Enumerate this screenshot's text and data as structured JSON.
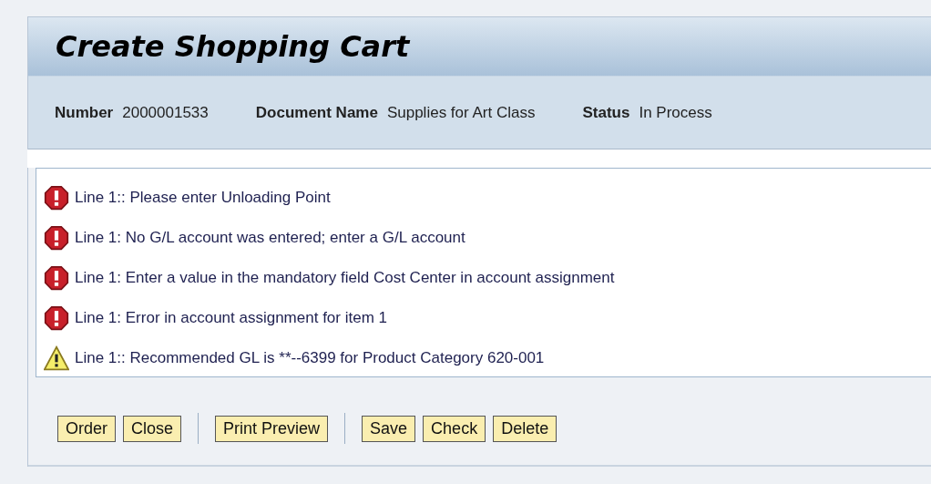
{
  "title": "Create Shopping Cart",
  "header_fields": [
    {
      "label": "Number",
      "value": "2000001533"
    },
    {
      "label": "Document Name",
      "value": "Supplies for Art Class"
    },
    {
      "label": "Status",
      "value": "In Process"
    }
  ],
  "messages": [
    {
      "kind": "error",
      "text": "Line 1:: Please enter Unloading Point"
    },
    {
      "kind": "error",
      "text": "Line 1: No G/L account was entered; enter a G/L account"
    },
    {
      "kind": "error",
      "text": "Line 1: Enter a value in the mandatory field Cost Center in account assignment"
    },
    {
      "kind": "error",
      "text": "Line 1: Error in account assignment for item 1"
    },
    {
      "kind": "warning",
      "text": "Line 1:: Recommended GL is **--6399 for Product Category 620-001"
    }
  ],
  "button_groups": [
    [
      "Order",
      "Close"
    ],
    [
      "Print Preview"
    ],
    [
      "Save",
      "Check",
      "Delete"
    ]
  ]
}
